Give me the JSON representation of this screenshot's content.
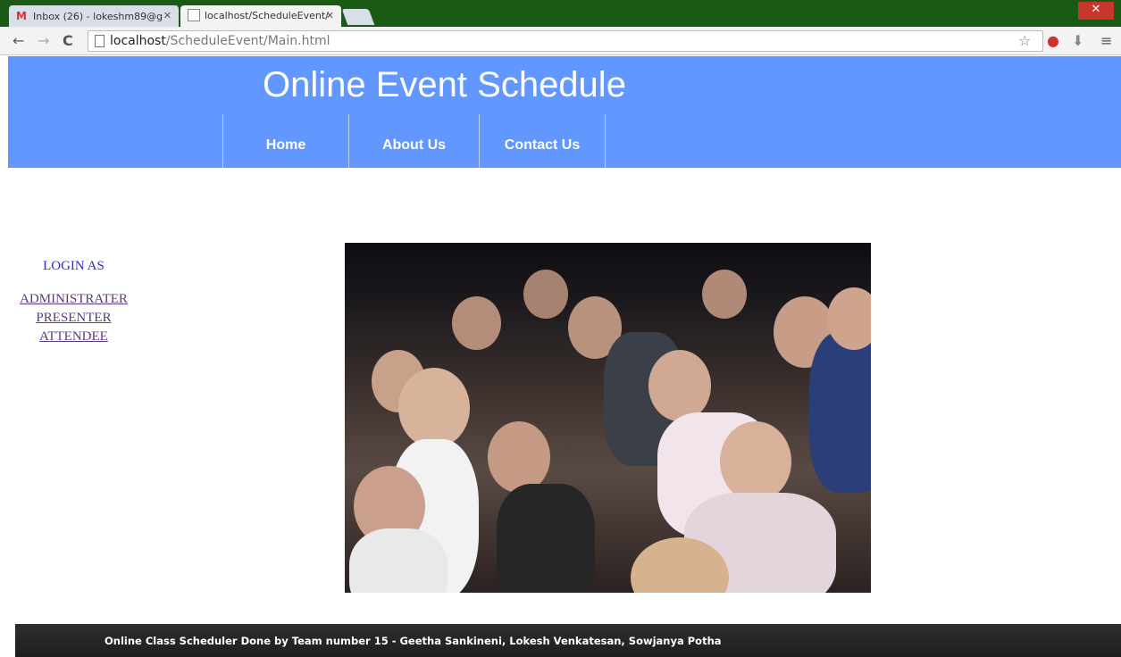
{
  "browser": {
    "tabs": [
      {
        "label": "Inbox (26) - lokeshm89@g",
        "icon": "gmail-icon"
      },
      {
        "label": "localhost/ScheduleEvent/",
        "icon": "page-icon"
      }
    ],
    "url_host": "localhost",
    "url_path": "/ScheduleEvent/Main.html"
  },
  "header": {
    "title": "Online Event Schedule",
    "nav": {
      "home": "Home",
      "about": "About Us",
      "contact": "Contact Us"
    }
  },
  "login": {
    "heading": "LOGIN AS",
    "links": {
      "admin": "ADMINISTRATER",
      "presenter": "PRESENTER",
      "attendee": "ATTENDEE"
    }
  },
  "footer": {
    "text": "Online Class Scheduler Done by Team number 15 - Geetha Sankineni, Lokesh Venkatesan, Sowjanya Potha"
  },
  "colors": {
    "header_bg": "#6197ff",
    "link": "#5b3a7e",
    "footer_bg": "#1e1e1e"
  }
}
